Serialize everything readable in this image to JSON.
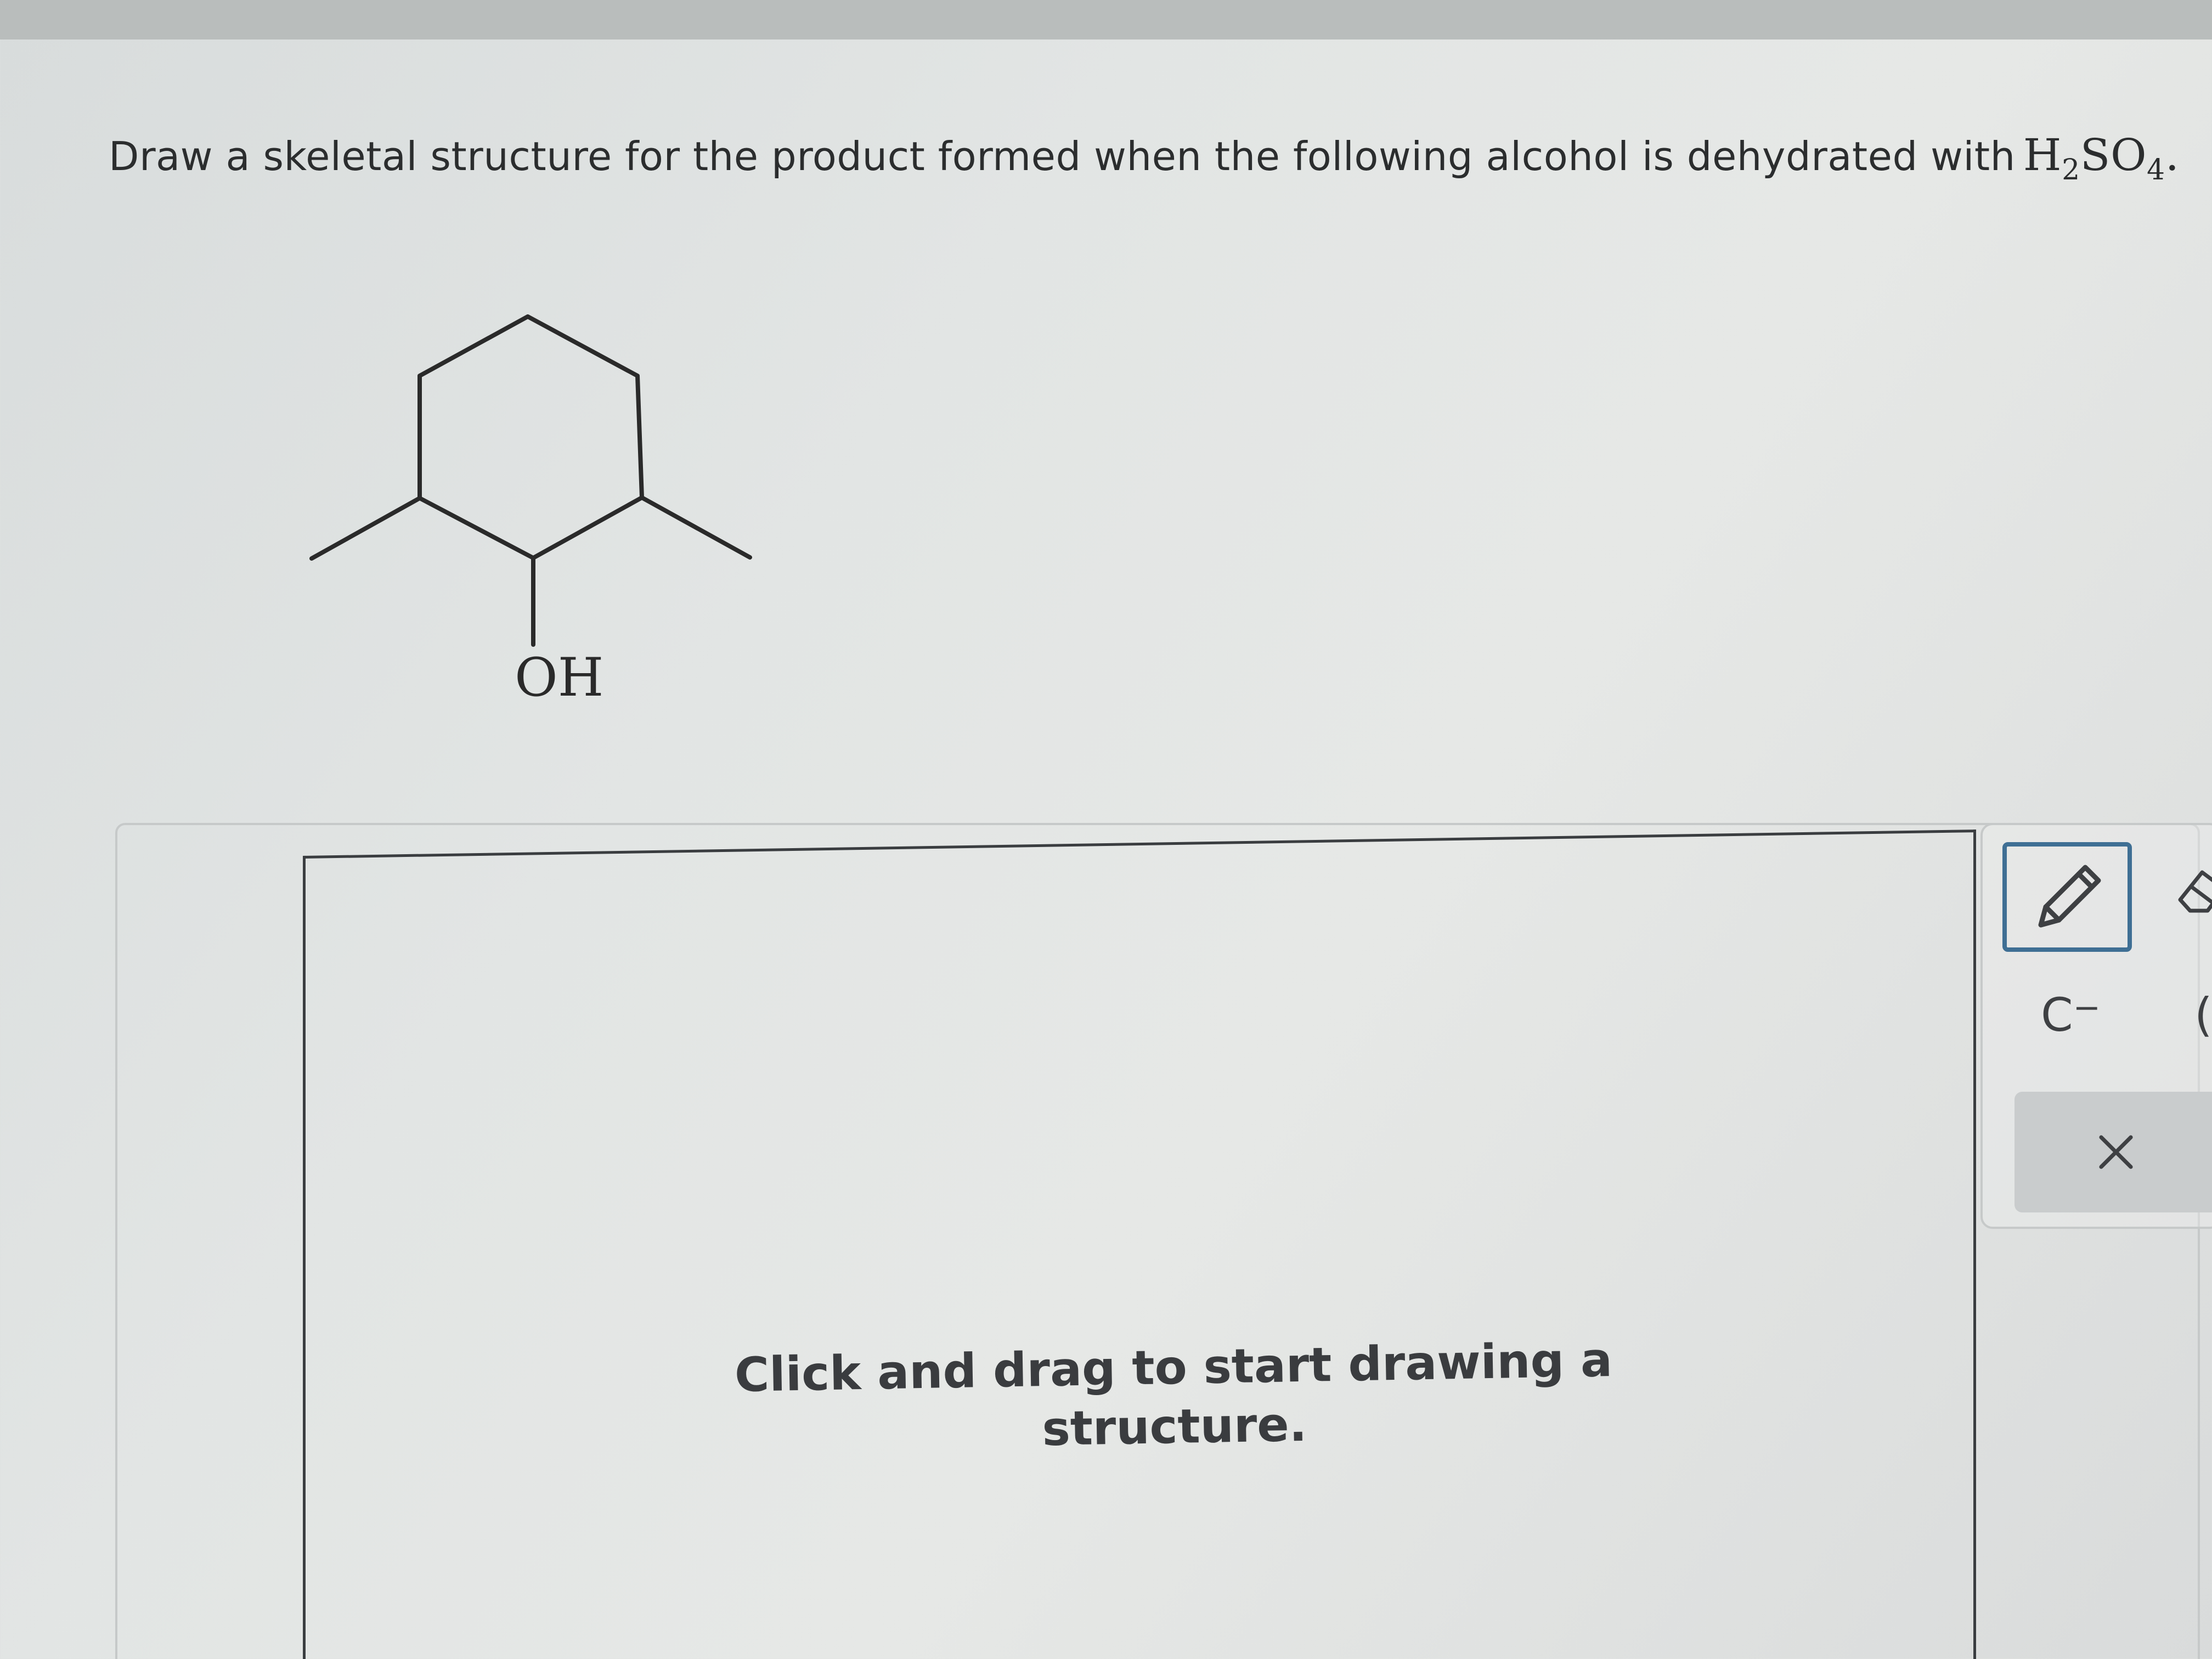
{
  "question": {
    "text": "Draw a skeletal structure for the product formed when the following alcohol is dehydrated with",
    "formula": {
      "part1": "H",
      "sub1": "2",
      "part2": "SO",
      "sub2": "4",
      "tail": "."
    }
  },
  "molecule": {
    "substituent_label": "OH"
  },
  "canvas": {
    "hint": "Click and drag to start drawing a structure."
  },
  "toolbar": {
    "pencil_icon": "pencil-icon",
    "eraser_icon": "eraser-icon",
    "carbanion_label": "C",
    "carbanion_charge": "−",
    "partial_label": "(",
    "clear_icon": "close-icon"
  },
  "colors": {
    "selected_tool_border": "#3f6f94",
    "text": "#2b2d2e",
    "clear_button_bg": "#c9cccd"
  }
}
